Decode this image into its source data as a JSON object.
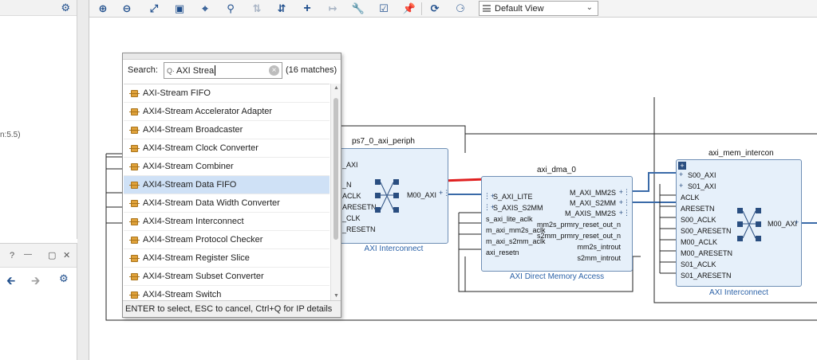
{
  "left_panel": {
    "top_clip_text": "n:5.5)",
    "bottom_controls": [
      "?",
      "—",
      "▢",
      "✕"
    ]
  },
  "toolbar": {
    "view_selector": "Default View",
    "icons": [
      "zoom-in-icon",
      "zoom-out-icon",
      "fit-full-icon",
      "fit-selection-icon",
      "select-area-icon",
      "search-icon",
      "collapse-icon",
      "expand-icon",
      "add-ip-icon",
      "route-icon",
      "wrench-icon",
      "validate-icon",
      "pin-icon",
      "refresh-icon",
      "optimize-icon"
    ]
  },
  "popup": {
    "search_label": "Search:",
    "search_value": "AXI Strea",
    "match_count": "(16 matches)",
    "results": [
      "AXI-Stream FIFO",
      "AXI4-Stream Accelerator Adapter",
      "AXI4-Stream Broadcaster",
      "AXI4-Stream Clock Converter",
      "AXI4-Stream Combiner",
      "AXI4-Stream Data FIFO",
      "AXI4-Stream Data Width Converter",
      "AXI4-Stream Interconnect",
      "AXI4-Stream Protocol Checker",
      "AXI4-Stream Register Slice",
      "AXI4-Stream Subset Converter",
      "AXI4-Stream Switch"
    ],
    "selected_index": 5,
    "footer": "ENTER to select, ESC to cancel, Ctrl+Q for IP details"
  },
  "diagram": {
    "ps7_periph": {
      "title": "ps7_0_axi_periph",
      "subtitle": "AXI Interconnect",
      "left_ports": [
        "_AXI",
        "_N",
        "ACLK",
        "ARESETN",
        "_CLK",
        "_RESETN"
      ],
      "right_port": "M00_AXI"
    },
    "axi_dma": {
      "title": "axi_dma_0",
      "subtitle": "AXI Direct Memory Access",
      "left_ports": [
        "S_AXI_LITE",
        "S_AXIS_S2MM",
        "s_axi_lite_aclk",
        "m_axi_mm2s_aclk",
        "m_axi_s2mm_aclk",
        "axi_resetn"
      ],
      "right_ports": [
        "M_AXI_MM2S",
        "M_AXI_S2MM",
        "M_AXIS_MM2S",
        "mm2s_prmry_reset_out_n",
        "s2mm_prmry_reset_out_n",
        "mm2s_introut",
        "s2mm_introut"
      ]
    },
    "mem_intercon": {
      "title": "axi_mem_intercon",
      "subtitle": "AXI Interconnect",
      "left_ports": [
        "S00_AXI",
        "S01_AXI",
        "ACLK",
        "ARESETN",
        "S00_ACLK",
        "S00_ARESETN",
        "M00_ACLK",
        "M00_ARESETN",
        "S01_ACLK",
        "S01_ARESETN"
      ],
      "right_port": "M00_AXI"
    }
  },
  "colors": {
    "arrow": "#e02020",
    "block_fill": "#e6f0fa",
    "block_border": "#6f8fb5",
    "selected_row": "#cfe1f6",
    "wire_bus": "#3a6aa8"
  }
}
